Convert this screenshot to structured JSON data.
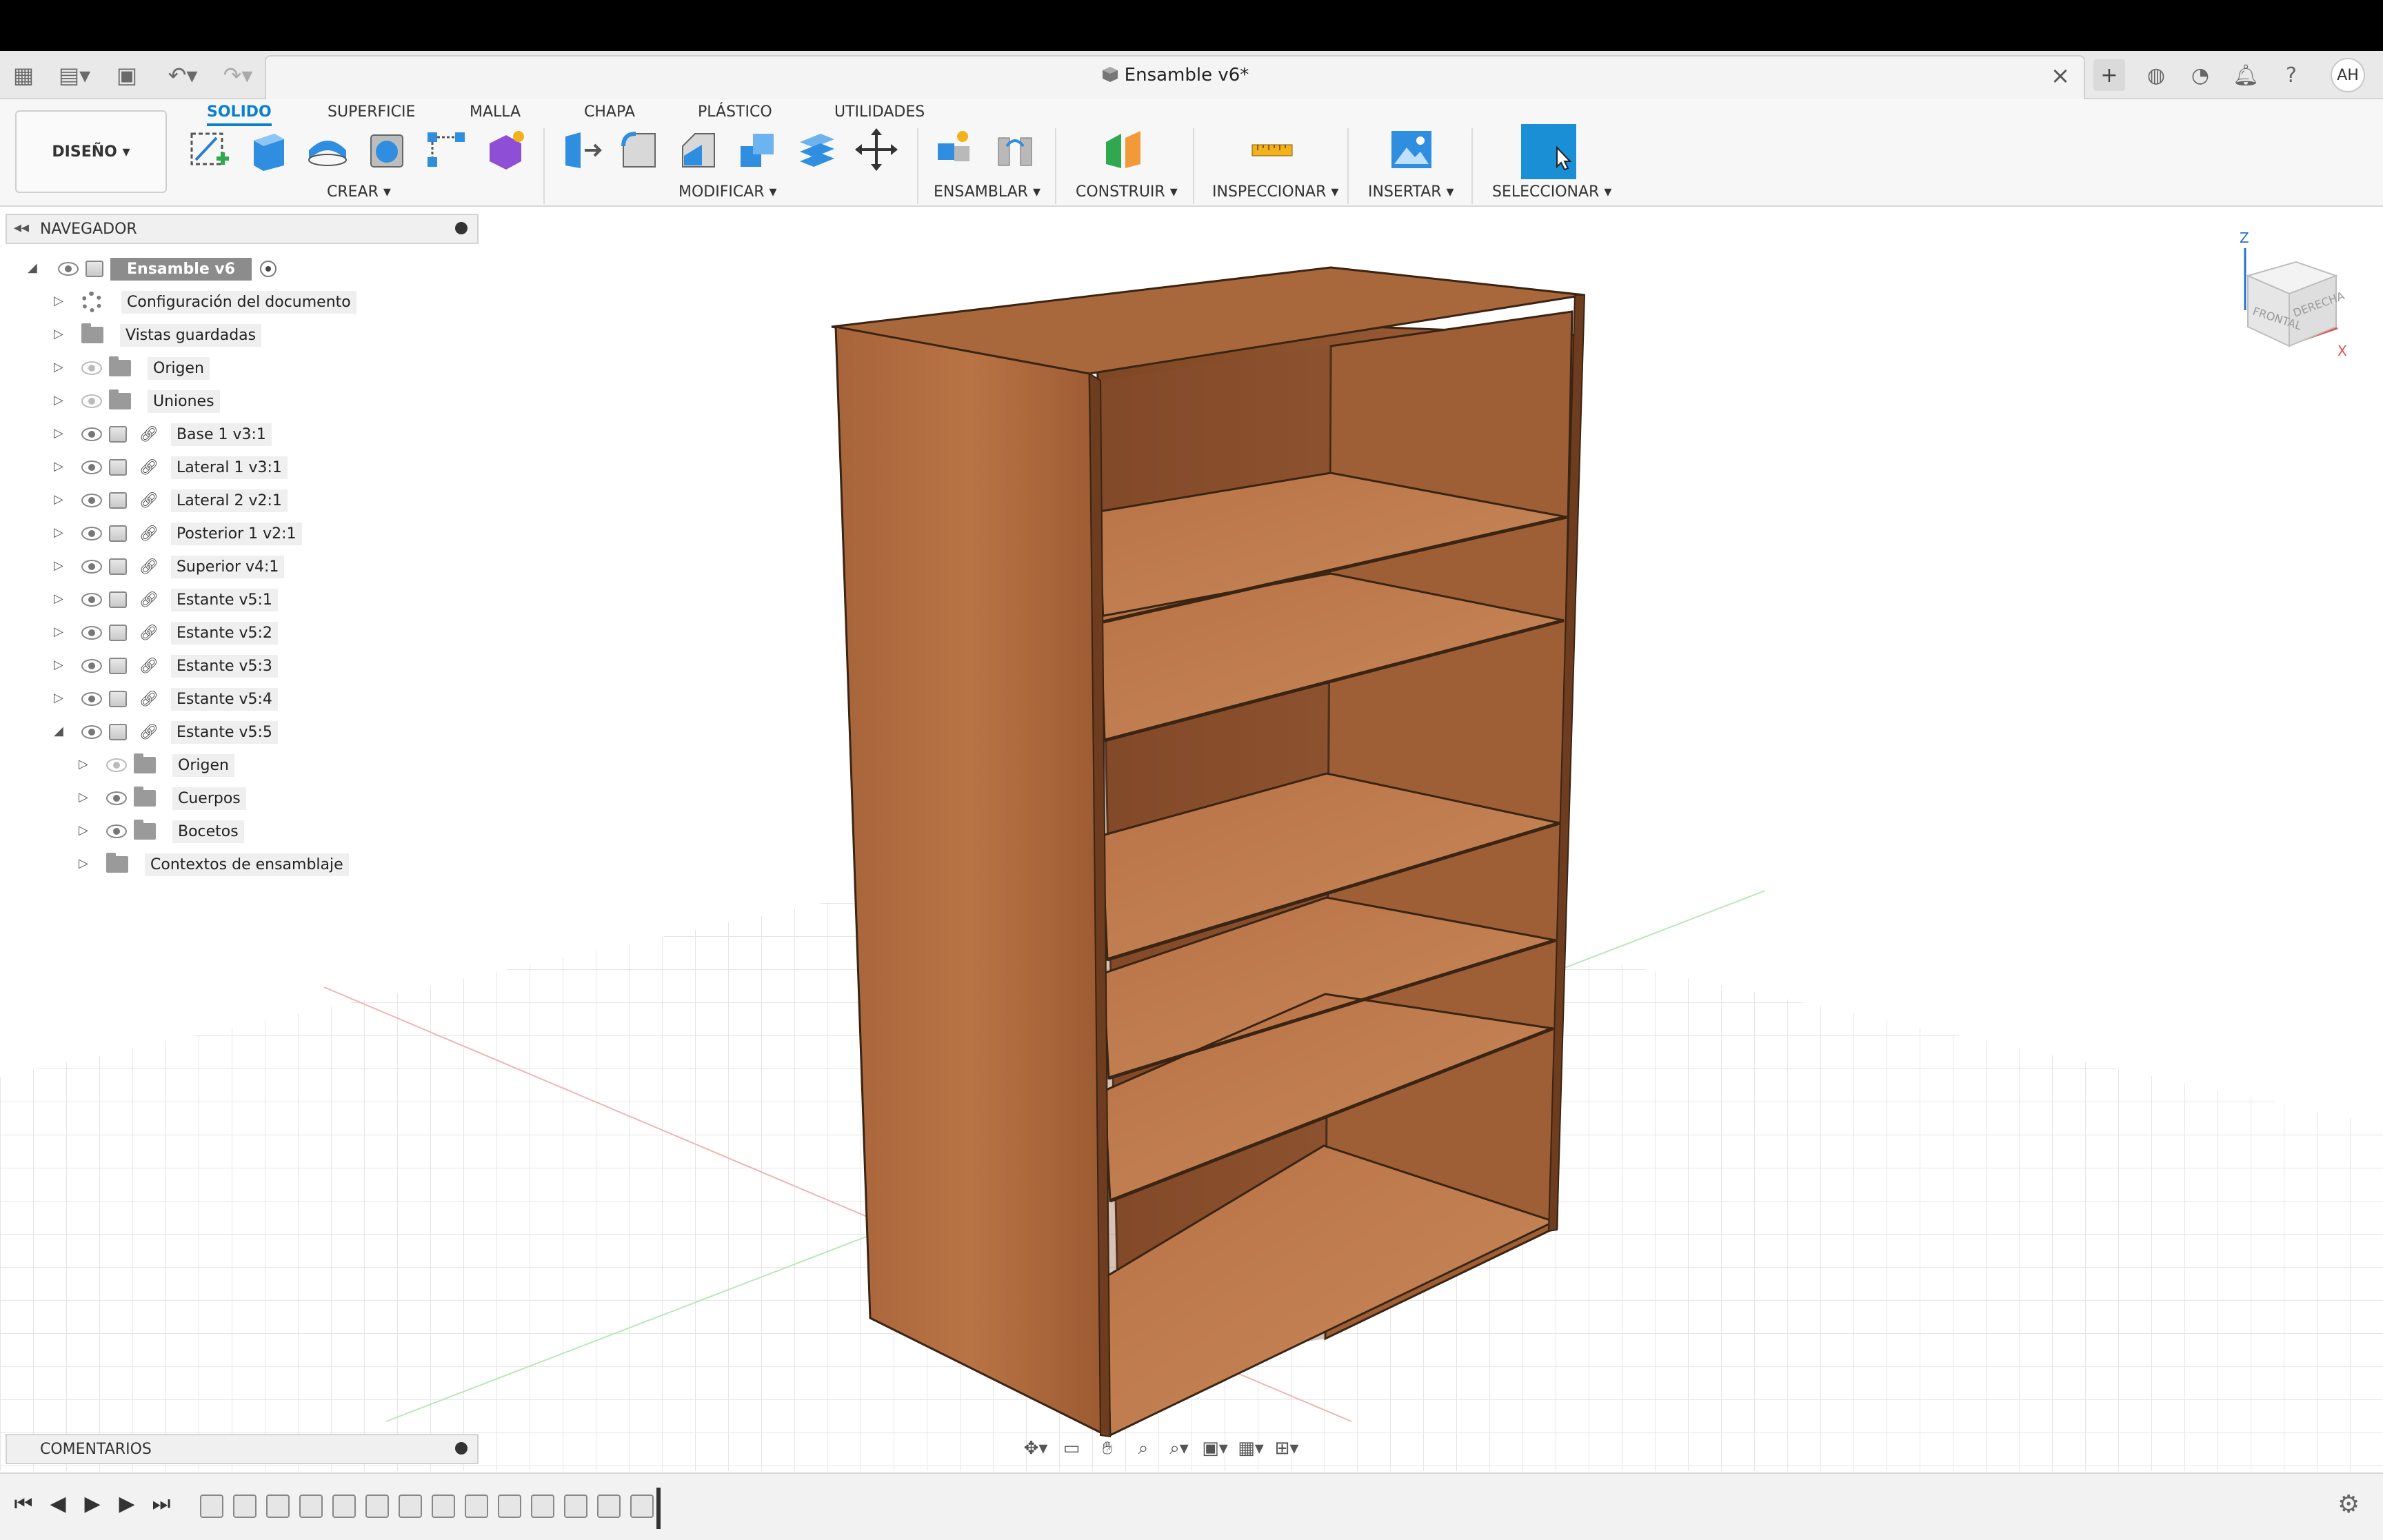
{
  "document": {
    "title": "Ensamble v6*"
  },
  "user": {
    "initials": "AH"
  },
  "workspace": {
    "label": "DISEÑO ▾"
  },
  "tabs": [
    "SOLIDO",
    "SUPERFICIE",
    "MALLA",
    "CHAPA",
    "PLÁSTICO",
    "UTILIDADES"
  ],
  "groups": {
    "crear": "CREAR ▾",
    "modificar": "MODIFICAR ▾",
    "ensamblar": "ENSAMBLAR ▾",
    "construir": "CONSTRUIR ▾",
    "inspeccionar": "INSPECCIONAR ▾",
    "insertar": "INSERTAR ▾",
    "seleccionar": "SELECCIONAR ▾"
  },
  "navigator": {
    "title": "NAVEGADOR",
    "root": "Ensamble v6",
    "items": [
      "Configuración del documento",
      "Vistas guardadas",
      "Origen",
      "Uniones",
      "Base 1 v3:1",
      "Lateral 1 v3:1",
      "Lateral 2 v2:1",
      "Posterior 1 v2:1",
      "Superior v4:1",
      "Estante v5:1",
      "Estante v5:2",
      "Estante v5:3",
      "Estante v5:4",
      "Estante v5:5"
    ],
    "subitems": [
      "Origen",
      "Cuerpos",
      "Bocetos",
      "Contextos de ensamblaje"
    ]
  },
  "comments": {
    "title": "COMENTARIOS"
  },
  "viewcube": {
    "front": "FRONTAL",
    "right": "DERECHA",
    "z": "Z",
    "x": "X"
  },
  "colors": {
    "accent": "#0a7fd0",
    "wood": "#b06a3c",
    "select_blue": "#1a8fd6"
  }
}
